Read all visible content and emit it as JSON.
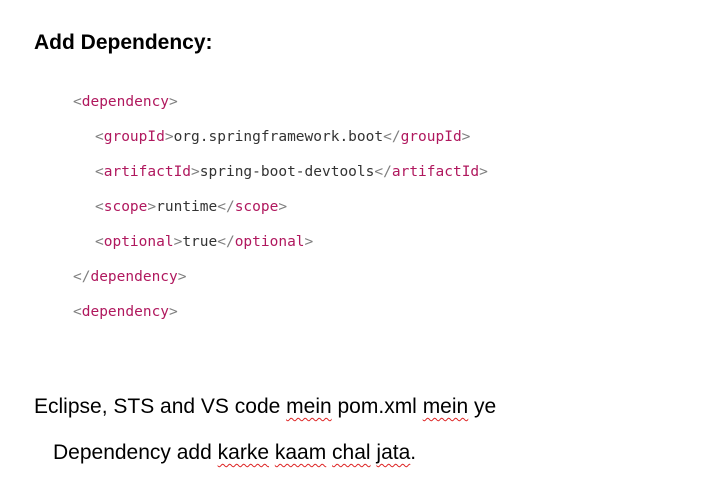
{
  "heading": "Add Dependency:",
  "code": {
    "line1": {
      "tag": "dependency"
    },
    "line2": {
      "tag": "groupId",
      "value": "org.springframework.boot"
    },
    "line3": {
      "tag": "artifactId",
      "value": "spring-boot-devtools"
    },
    "line4": {
      "tag": "scope",
      "value": "runtime"
    },
    "line5": {
      "tag": "optional",
      "value": "true"
    },
    "line6": {
      "tag": "dependency"
    },
    "line7": {
      "tag": "dependency"
    }
  },
  "prose": {
    "line1": {
      "t1": "Eclipse, STS and VS code ",
      "w1": "mein",
      "t2": " pom.xml ",
      "w2": "mein",
      "t3": " ye"
    },
    "line2": {
      "t1": "Dependency add ",
      "w1": "karke",
      "t2": " ",
      "w2": "kaam",
      "t3": " ",
      "w3": "chal",
      "t4": " ",
      "w4": "jata",
      "t5": "."
    }
  }
}
